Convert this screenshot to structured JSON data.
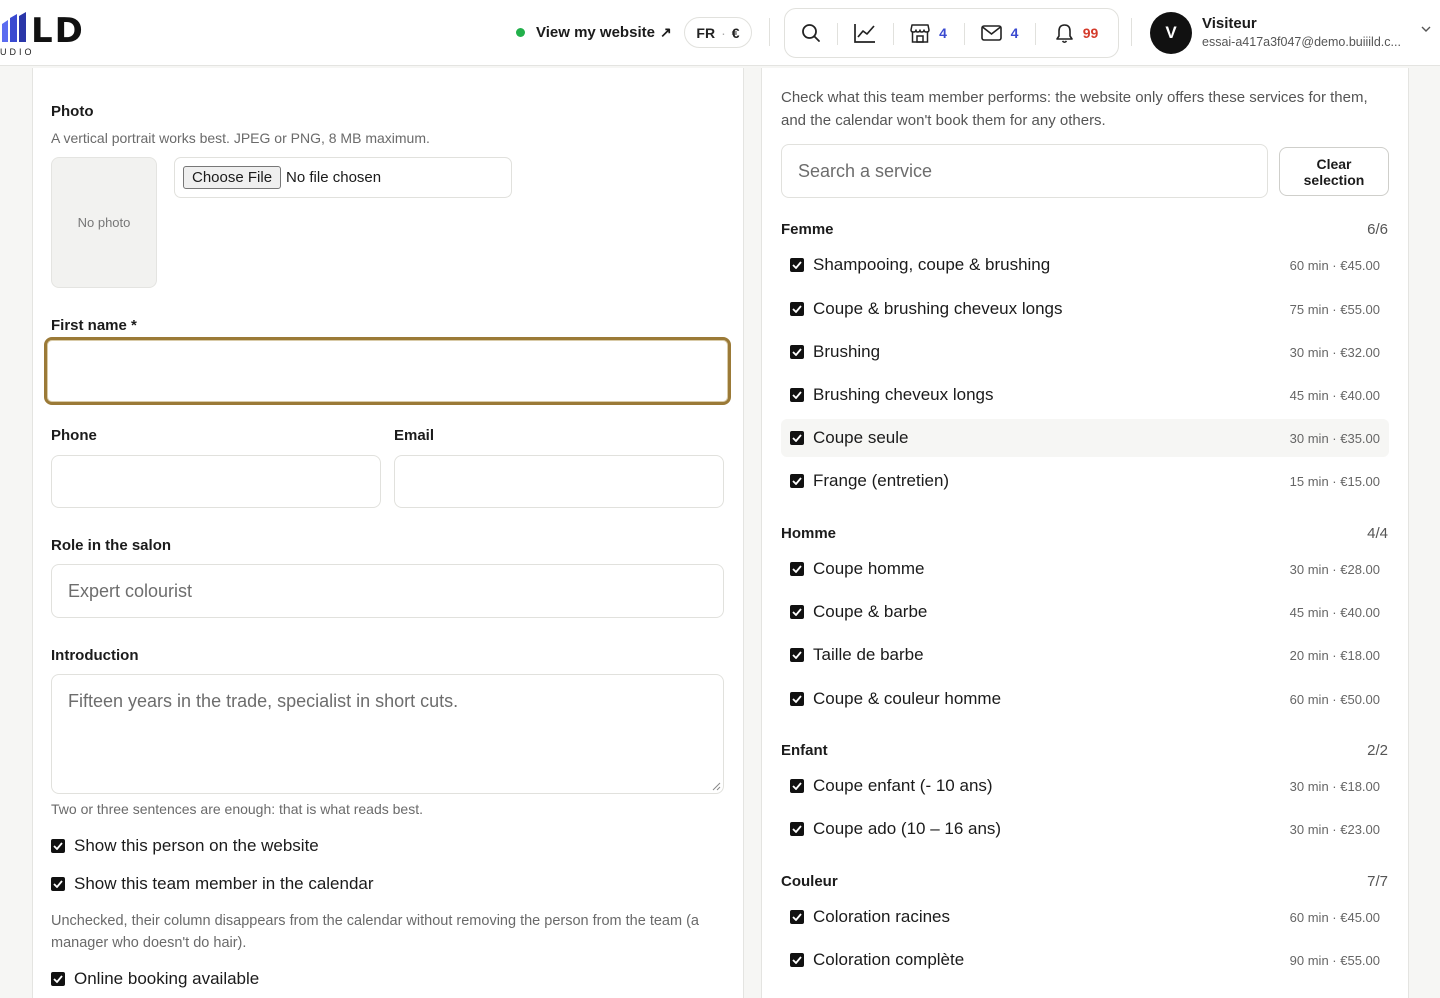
{
  "header": {
    "logo_text": "LD",
    "logo_sub": "UDIO",
    "view_site": "View my website",
    "view_site_arrow": "↗",
    "lang": "FR",
    "currency": "€",
    "shop_count": "4",
    "mail_count": "4",
    "notif_count": "99",
    "avatar_letter": "V",
    "user_name": "Visiteur",
    "user_email": "essai-a417a3f047@demo.buiiild.c...",
    "colors": {
      "accent_count": "#3a4ad0",
      "alert_count": "#d43a2a",
      "online_dot": "#22b04b"
    }
  },
  "form": {
    "photo_label": "Photo",
    "photo_help": "A vertical portrait works best. JPEG or PNG, 8 MB maximum.",
    "no_photo": "No photo",
    "file_button": "Choose File",
    "file_status": "No file chosen",
    "first_name_label": "First name *",
    "first_name_value": "",
    "phone_label": "Phone",
    "phone_value": "",
    "email_label": "Email",
    "email_value": "",
    "role_label": "Role in the salon",
    "role_placeholder": "Expert colourist",
    "intro_label": "Introduction",
    "intro_placeholder": "Fifteen years in the trade, specialist in short cuts.",
    "intro_help": "Two or three sentences are enough: that is what reads best.",
    "show_on_website": "Show this person on the website",
    "show_in_calendar": "Show this team member in the calendar",
    "calendar_help": "Unchecked, their column disappears from the calendar without removing the person from the team (a manager who doesn't do hair).",
    "online_booking": "Online booking available",
    "focus_color": "#9b7a37"
  },
  "services": {
    "intro": "Check what this team member performs: the website only offers these services for them, and the calendar won't book them for any others.",
    "search_placeholder": "Search a service",
    "clear_button": "Clear selection",
    "categories": [
      {
        "title": "Femme",
        "count": "6/6",
        "items": [
          {
            "name": "Shampooing, coupe & brushing",
            "meta": "60 min · €45.00",
            "checked": true
          },
          {
            "name": "Coupe & brushing cheveux longs",
            "meta": "75 min · €55.00",
            "checked": true
          },
          {
            "name": "Brushing",
            "meta": "30 min · €32.00",
            "checked": true
          },
          {
            "name": "Brushing cheveux longs",
            "meta": "45 min · €40.00",
            "checked": true
          },
          {
            "name": "Coupe seule",
            "meta": "30 min · €35.00",
            "checked": true
          },
          {
            "name": "Frange (entretien)",
            "meta": "15 min · €15.00",
            "checked": true
          }
        ]
      },
      {
        "title": "Homme",
        "count": "4/4",
        "items": [
          {
            "name": "Coupe homme",
            "meta": "30 min · €28.00",
            "checked": true
          },
          {
            "name": "Coupe & barbe",
            "meta": "45 min · €40.00",
            "checked": true
          },
          {
            "name": "Taille de barbe",
            "meta": "20 min · €18.00",
            "checked": true
          },
          {
            "name": "Coupe & couleur homme",
            "meta": "60 min · €50.00",
            "checked": true
          }
        ]
      },
      {
        "title": "Enfant",
        "count": "2/2",
        "items": [
          {
            "name": "Coupe enfant (- 10 ans)",
            "meta": "30 min · €18.00",
            "checked": true
          },
          {
            "name": "Coupe ado (10 – 16 ans)",
            "meta": "30 min · €23.00",
            "checked": true
          }
        ]
      },
      {
        "title": "Couleur",
        "count": "7/7",
        "items": [
          {
            "name": "Coloration racines",
            "meta": "60 min · €45.00",
            "checked": true
          },
          {
            "name": "Coloration complète",
            "meta": "90 min · €55.00",
            "checked": true
          }
        ]
      }
    ]
  }
}
